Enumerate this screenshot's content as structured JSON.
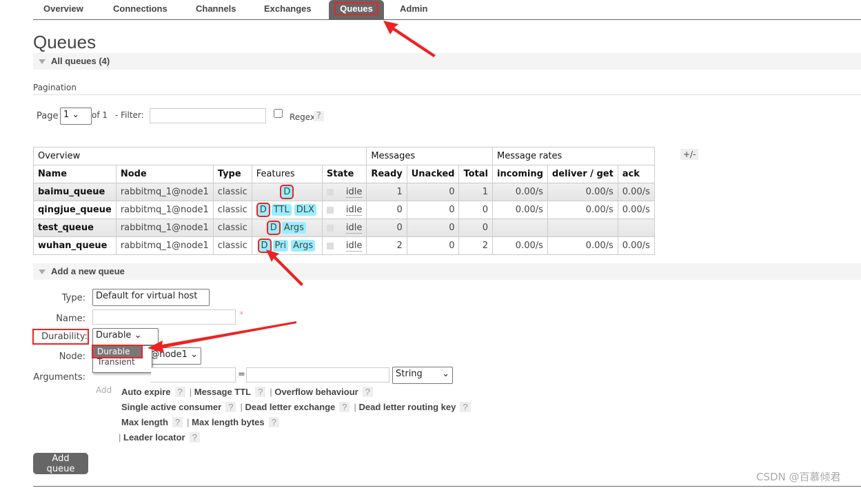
{
  "nav": {
    "tabs": [
      "Overview",
      "Connections",
      "Channels",
      "Exchanges",
      "Queues",
      "Admin"
    ],
    "active": "Queues"
  },
  "page_title": "Queues",
  "all_queues": {
    "header": "All queues (4)"
  },
  "pagination": {
    "label": "Pagination",
    "page_label": "Page",
    "page_value": "1",
    "of_label": "of 1",
    "filter_label": "- Filter:",
    "filter_value": "",
    "regex_label": "Regex",
    "help": "?"
  },
  "table": {
    "groups": [
      "Overview",
      "Messages",
      "Message rates"
    ],
    "toggle": "+/-",
    "columns": [
      "Name",
      "Node",
      "Type",
      "Features",
      "State",
      "Ready",
      "Unacked",
      "Total",
      "incoming",
      "deliver / get",
      "ack"
    ],
    "rows": [
      {
        "name": "baimu_queue",
        "node": "rabbitmq_1@node1",
        "type": "classic",
        "features": [
          "D"
        ],
        "state": "idle",
        "ready": "1",
        "unacked": "0",
        "total": "1",
        "incoming": "0.00/s",
        "deliver": "0.00/s",
        "ack": "0.00/s"
      },
      {
        "name": "qingjue_queue",
        "node": "rabbitmq_1@node1",
        "type": "classic",
        "features": [
          "D",
          "TTL",
          "DLX"
        ],
        "state": "idle",
        "ready": "0",
        "unacked": "0",
        "total": "0",
        "incoming": "0.00/s",
        "deliver": "0.00/s",
        "ack": "0.00/s"
      },
      {
        "name": "test_queue",
        "node": "rabbitmq_1@node1",
        "type": "classic",
        "features": [
          "D",
          "Args"
        ],
        "state": "idle",
        "ready": "0",
        "unacked": "0",
        "total": "0",
        "incoming": "",
        "deliver": "",
        "ack": ""
      },
      {
        "name": "wuhan_queue",
        "node": "rabbitmq_1@node1",
        "type": "classic",
        "features": [
          "D",
          "Pri",
          "Args"
        ],
        "state": "idle",
        "ready": "2",
        "unacked": "0",
        "total": "2",
        "incoming": "0.00/s",
        "deliver": "0.00/s",
        "ack": "0.00/s"
      }
    ]
  },
  "add_queue": {
    "header": "Add a new queue",
    "type_label": "Type:",
    "type_value": "Default for virtual host",
    "name_label": "Name:",
    "name_value": "",
    "required": "*",
    "durability_label": "Durability:",
    "durability_value": "Durable",
    "durability_options": [
      "Durable",
      "Transient"
    ],
    "node_label": "Node:",
    "node_value": "rabbitmq_1@node1",
    "arguments_label": "Arguments:",
    "eq": "=",
    "arg_type": "String",
    "add_label": "Add",
    "arg_links": [
      [
        "Auto expire",
        "Message TTL",
        "Overflow behaviour"
      ],
      [
        "Single active consumer",
        "Dead letter exchange",
        "Dead letter routing key"
      ],
      [
        "Max length",
        "Max length bytes"
      ],
      [
        "Leader locator"
      ]
    ],
    "submit": "Add queue"
  },
  "watermark": "CSDN @百慕倾君",
  "colors": {
    "feature_badge": "#99eeff",
    "annotation": "#ee2222",
    "active_tab": "#666666"
  }
}
